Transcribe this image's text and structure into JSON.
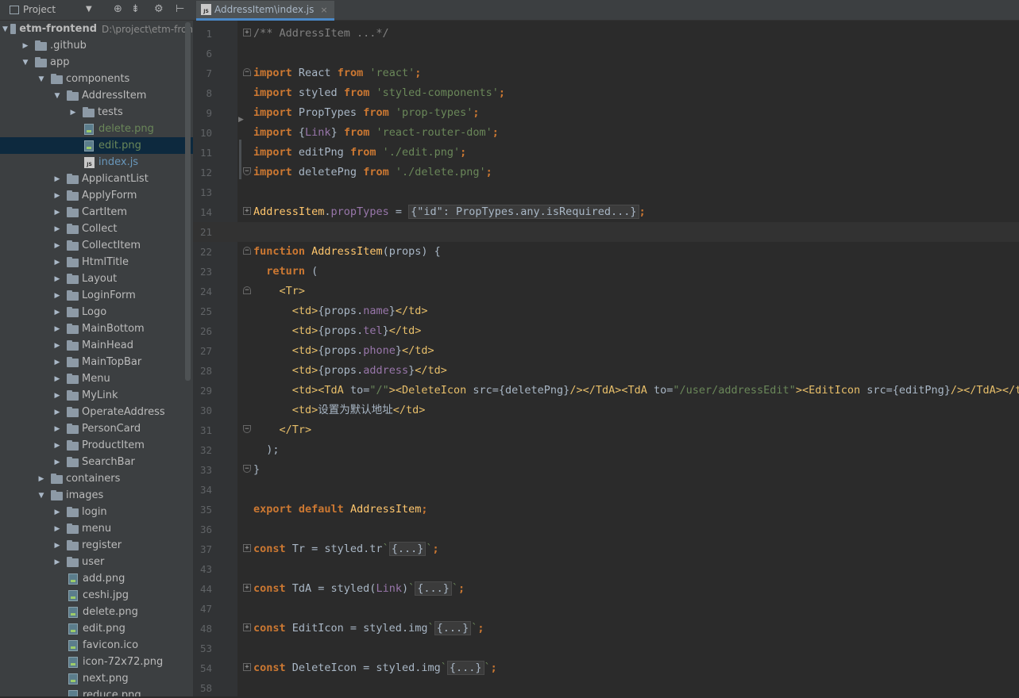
{
  "project_panel": {
    "title": "Project",
    "dropdown_arrow": "▼",
    "toolbar_icons": [
      "locate-icon",
      "collapse-all-icon",
      "settings-icon",
      "hide-icon"
    ]
  },
  "tree": [
    {
      "label": "etm-frontend",
      "path": "D:\\project\\etm-fron",
      "depth": 0,
      "expanded": true,
      "type": "root"
    },
    {
      "label": ".github",
      "depth": 1,
      "expanded": false,
      "type": "folder"
    },
    {
      "label": "app",
      "depth": 1,
      "expanded": true,
      "type": "folder"
    },
    {
      "label": "components",
      "depth": 2,
      "expanded": true,
      "type": "folder"
    },
    {
      "label": "AddressItem",
      "depth": 3,
      "expanded": true,
      "type": "folder"
    },
    {
      "label": "tests",
      "depth": 4,
      "expanded": false,
      "type": "folder"
    },
    {
      "label": "delete.png",
      "depth": 4,
      "type": "image",
      "color": "green"
    },
    {
      "label": "edit.png",
      "depth": 4,
      "type": "image",
      "color": "green",
      "selected": true
    },
    {
      "label": "index.js",
      "depth": 4,
      "type": "js",
      "color": "blue"
    },
    {
      "label": "ApplicantList",
      "depth": 3,
      "expanded": false,
      "type": "folder"
    },
    {
      "label": "ApplyForm",
      "depth": 3,
      "expanded": false,
      "type": "folder"
    },
    {
      "label": "CartItem",
      "depth": 3,
      "expanded": false,
      "type": "folder"
    },
    {
      "label": "Collect",
      "depth": 3,
      "expanded": false,
      "type": "folder"
    },
    {
      "label": "CollectItem",
      "depth": 3,
      "expanded": false,
      "type": "folder"
    },
    {
      "label": "HtmlTitle",
      "depth": 3,
      "expanded": false,
      "type": "folder"
    },
    {
      "label": "Layout",
      "depth": 3,
      "expanded": false,
      "type": "folder"
    },
    {
      "label": "LoginForm",
      "depth": 3,
      "expanded": false,
      "type": "folder"
    },
    {
      "label": "Logo",
      "depth": 3,
      "expanded": false,
      "type": "folder"
    },
    {
      "label": "MainBottom",
      "depth": 3,
      "expanded": false,
      "type": "folder"
    },
    {
      "label": "MainHead",
      "depth": 3,
      "expanded": false,
      "type": "folder"
    },
    {
      "label": "MainTopBar",
      "depth": 3,
      "expanded": false,
      "type": "folder"
    },
    {
      "label": "Menu",
      "depth": 3,
      "expanded": false,
      "type": "folder"
    },
    {
      "label": "MyLink",
      "depth": 3,
      "expanded": false,
      "type": "folder"
    },
    {
      "label": "OperateAddress",
      "depth": 3,
      "expanded": false,
      "type": "folder"
    },
    {
      "label": "PersonCard",
      "depth": 3,
      "expanded": false,
      "type": "folder"
    },
    {
      "label": "ProductItem",
      "depth": 3,
      "expanded": false,
      "type": "folder"
    },
    {
      "label": "SearchBar",
      "depth": 3,
      "expanded": false,
      "type": "folder"
    },
    {
      "label": "containers",
      "depth": 2,
      "expanded": false,
      "type": "folder"
    },
    {
      "label": "images",
      "depth": 2,
      "expanded": true,
      "type": "folder"
    },
    {
      "label": "login",
      "depth": 3,
      "expanded": false,
      "type": "folder"
    },
    {
      "label": "menu",
      "depth": 3,
      "expanded": false,
      "type": "folder"
    },
    {
      "label": "register",
      "depth": 3,
      "expanded": false,
      "type": "folder"
    },
    {
      "label": "user",
      "depth": 3,
      "expanded": false,
      "type": "folder"
    },
    {
      "label": "add.png",
      "depth": 3,
      "type": "image"
    },
    {
      "label": "ceshi.jpg",
      "depth": 3,
      "type": "image"
    },
    {
      "label": "delete.png",
      "depth": 3,
      "type": "image"
    },
    {
      "label": "edit.png",
      "depth": 3,
      "type": "image"
    },
    {
      "label": "favicon.ico",
      "depth": 3,
      "type": "image"
    },
    {
      "label": "icon-72x72.png",
      "depth": 3,
      "type": "image"
    },
    {
      "label": "next.png",
      "depth": 3,
      "type": "image"
    },
    {
      "label": "reduce.png",
      "depth": 3,
      "type": "image"
    }
  ],
  "editor": {
    "tab_label": "AddressItem\\index.js",
    "tab_close": "×",
    "file_icon_text": "JS",
    "lines": [
      {
        "n": "1",
        "fold": "plus",
        "tokens": [
          [
            "c",
            "/** AddressItem ...*/"
          ]
        ]
      },
      {
        "n": "6",
        "tokens": []
      },
      {
        "n": "7",
        "fold": "start",
        "tokens": [
          [
            "k",
            "import"
          ],
          [
            "",
            " React "
          ],
          [
            "k",
            "from"
          ],
          [
            "",
            " "
          ],
          [
            "s",
            "'react'"
          ],
          [
            "k",
            ";"
          ]
        ]
      },
      {
        "n": "8",
        "tokens": [
          [
            "k",
            "import"
          ],
          [
            "",
            " styled "
          ],
          [
            "k",
            "from"
          ],
          [
            "",
            " "
          ],
          [
            "s",
            "'styled-components'"
          ],
          [
            "k",
            ";"
          ]
        ]
      },
      {
        "n": "9",
        "tokens": [
          [
            "k",
            "import"
          ],
          [
            "",
            " PropTypes "
          ],
          [
            "k",
            "from"
          ],
          [
            "",
            " "
          ],
          [
            "s",
            "'prop-types'"
          ],
          [
            "k",
            ";"
          ]
        ]
      },
      {
        "n": "10",
        "tokens": [
          [
            "k",
            "import"
          ],
          [
            "",
            " {"
          ],
          [
            "p",
            "Link"
          ],
          [
            "",
            "} "
          ],
          [
            "k",
            "from"
          ],
          [
            "",
            " "
          ],
          [
            "s",
            "'react-router-dom'"
          ],
          [
            "k",
            ";"
          ]
        ]
      },
      {
        "n": "11",
        "tokens": [
          [
            "k",
            "import"
          ],
          [
            "",
            " editPng "
          ],
          [
            "k",
            "from"
          ],
          [
            "",
            " "
          ],
          [
            "s",
            "'./edit.png'"
          ],
          [
            "k",
            ";"
          ]
        ]
      },
      {
        "n": "12",
        "fold": "end",
        "tokens": [
          [
            "k",
            "import"
          ],
          [
            "",
            " deletePng "
          ],
          [
            "k",
            "from"
          ],
          [
            "",
            " "
          ],
          [
            "s",
            "'./delete.png'"
          ],
          [
            "k",
            ";"
          ]
        ]
      },
      {
        "n": "13",
        "tokens": []
      },
      {
        "n": "14",
        "fold": "plus",
        "tokens": [
          [
            "f",
            "AddressItem"
          ],
          [
            "",
            "."
          ],
          [
            "p",
            "propTypes"
          ],
          [
            "",
            " = "
          ],
          [
            "box",
            "{\"id\": PropTypes.any.isRequired...}"
          ],
          [
            "k",
            ";"
          ]
        ]
      },
      {
        "n": "21",
        "highlight": true,
        "tokens": []
      },
      {
        "n": "22",
        "fold": "start",
        "tokens": [
          [
            "k",
            "function"
          ],
          [
            "",
            " "
          ],
          [
            "f",
            "AddressItem"
          ],
          [
            "",
            "(props) {"
          ]
        ]
      },
      {
        "n": "23",
        "tokens": [
          [
            "",
            "  "
          ],
          [
            "k",
            "return"
          ],
          [
            "",
            " ("
          ]
        ]
      },
      {
        "n": "24",
        "fold": "start",
        "tokens": [
          [
            "",
            "    "
          ],
          [
            "t",
            "<Tr>"
          ]
        ]
      },
      {
        "n": "25",
        "tokens": [
          [
            "",
            "      "
          ],
          [
            "t",
            "<td>"
          ],
          [
            "",
            "{props."
          ],
          [
            "p",
            "name"
          ],
          [
            "",
            "}"
          ],
          [
            "t",
            "</td>"
          ]
        ]
      },
      {
        "n": "26",
        "tokens": [
          [
            "",
            "      "
          ],
          [
            "t",
            "<td>"
          ],
          [
            "",
            "{props."
          ],
          [
            "p",
            "tel"
          ],
          [
            "",
            "}"
          ],
          [
            "t",
            "</td>"
          ]
        ]
      },
      {
        "n": "27",
        "tokens": [
          [
            "",
            "      "
          ],
          [
            "t",
            "<td>"
          ],
          [
            "",
            "{props."
          ],
          [
            "p",
            "phone"
          ],
          [
            "",
            "}"
          ],
          [
            "t",
            "</td>"
          ]
        ]
      },
      {
        "n": "28",
        "tokens": [
          [
            "",
            "      "
          ],
          [
            "t",
            "<td>"
          ],
          [
            "",
            "{props."
          ],
          [
            "p",
            "address"
          ],
          [
            "",
            "}"
          ],
          [
            "t",
            "</td>"
          ]
        ]
      },
      {
        "n": "29",
        "tokens": [
          [
            "",
            "      "
          ],
          [
            "t",
            "<td><TdA"
          ],
          [
            "",
            " to="
          ],
          [
            "s",
            "\"/\""
          ],
          [
            "t",
            "><DeleteIcon"
          ],
          [
            "",
            " src={deletePng}"
          ],
          [
            "t",
            "/></TdA><TdA"
          ],
          [
            "",
            " to="
          ],
          [
            "s",
            "\"/user/addressEdit\""
          ],
          [
            "t",
            "><EditIcon"
          ],
          [
            "",
            " src={editPng}"
          ],
          [
            "t",
            "/></TdA></td>"
          ]
        ]
      },
      {
        "n": "30",
        "tokens": [
          [
            "",
            "      "
          ],
          [
            "t",
            "<td>"
          ],
          [
            "",
            "设置为默认地址"
          ],
          [
            "t",
            "</td>"
          ]
        ]
      },
      {
        "n": "31",
        "fold": "end",
        "tokens": [
          [
            "",
            "    "
          ],
          [
            "t",
            "</Tr>"
          ]
        ]
      },
      {
        "n": "32",
        "tokens": [
          [
            "",
            "  );"
          ]
        ]
      },
      {
        "n": "33",
        "fold": "end",
        "tokens": [
          [
            "",
            "}"
          ]
        ]
      },
      {
        "n": "34",
        "tokens": []
      },
      {
        "n": "35",
        "tokens": [
          [
            "k",
            "export default"
          ],
          [
            "",
            " "
          ],
          [
            "f",
            "AddressItem"
          ],
          [
            "k",
            ";"
          ]
        ]
      },
      {
        "n": "36",
        "tokens": []
      },
      {
        "n": "37",
        "fold": "plus",
        "tokens": [
          [
            "k",
            "const"
          ],
          [
            "",
            " Tr = styled.tr"
          ],
          [
            "s",
            "`"
          ],
          [
            "box",
            "{...}"
          ],
          [
            "s",
            "`"
          ],
          [
            "k",
            ";"
          ]
        ]
      },
      {
        "n": "43",
        "tokens": []
      },
      {
        "n": "44",
        "fold": "plus",
        "tokens": [
          [
            "k",
            "const"
          ],
          [
            "",
            " TdA = styled("
          ],
          [
            "p",
            "Link"
          ],
          [
            "",
            ")"
          ],
          [
            "s",
            "`"
          ],
          [
            "box",
            "{...}"
          ],
          [
            "s",
            "`"
          ],
          [
            "k",
            ";"
          ]
        ]
      },
      {
        "n": "47",
        "tokens": []
      },
      {
        "n": "48",
        "fold": "plus",
        "tokens": [
          [
            "k",
            "const"
          ],
          [
            "",
            " EditIcon = styled.img"
          ],
          [
            "s",
            "`"
          ],
          [
            "box",
            "{...}"
          ],
          [
            "s",
            "`"
          ],
          [
            "k",
            ";"
          ]
        ]
      },
      {
        "n": "53",
        "tokens": []
      },
      {
        "n": "54",
        "fold": "plus",
        "tokens": [
          [
            "k",
            "const"
          ],
          [
            "",
            " DeleteIcon = styled.img"
          ],
          [
            "s",
            "`"
          ],
          [
            "box",
            "{...}"
          ],
          [
            "s",
            "`"
          ],
          [
            "k",
            ";"
          ]
        ]
      },
      {
        "n": "58",
        "tokens": []
      }
    ]
  }
}
